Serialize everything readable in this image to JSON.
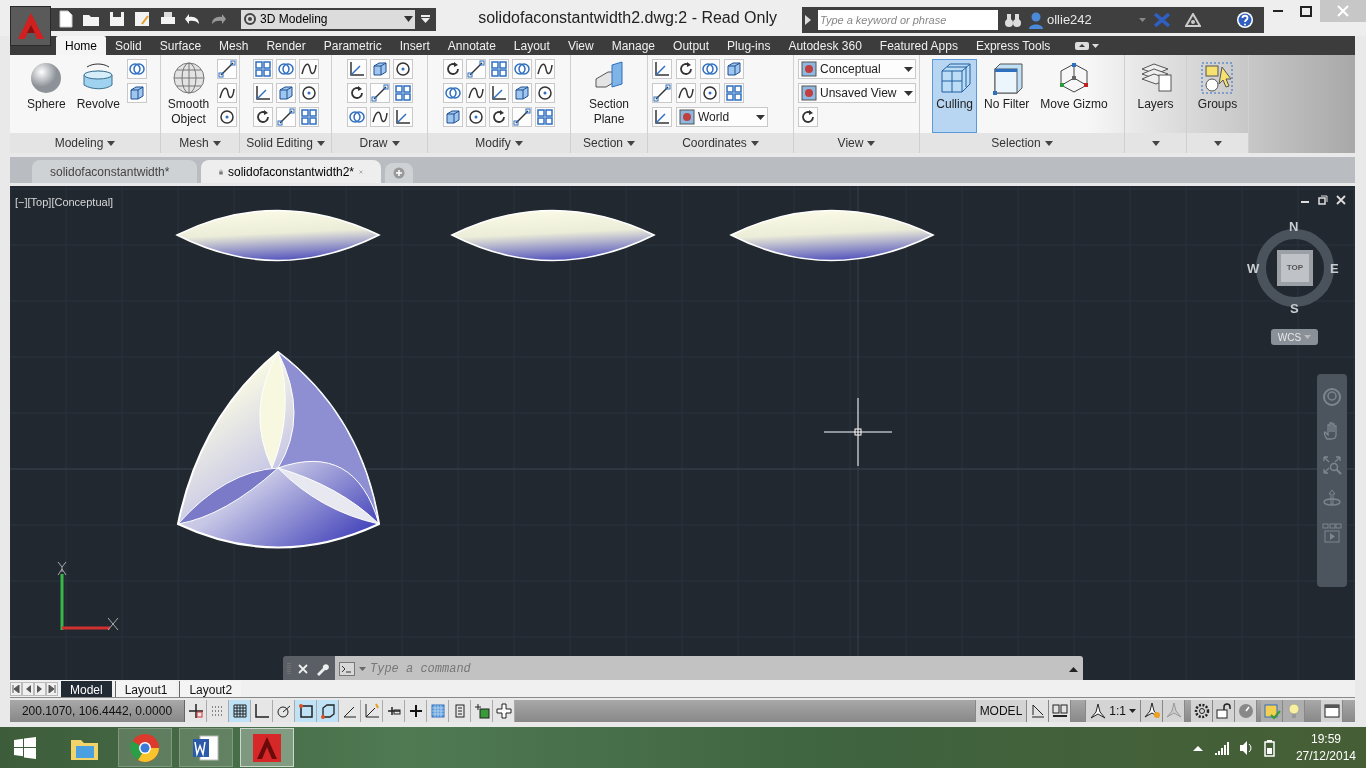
{
  "title_bar": {
    "workspace": "3D Modeling",
    "title": "solidofaconstantwidth2.dwg:2 - Read Only",
    "search": {
      "placeholder": "Type a keyword or phrase"
    },
    "user": "ollie242"
  },
  "ribbon_tabs": [
    {
      "label": "Home",
      "selected": true
    },
    {
      "label": "Solid",
      "selected": false
    },
    {
      "label": "Surface",
      "selected": false
    },
    {
      "label": "Mesh",
      "selected": false
    },
    {
      "label": "Render",
      "selected": false
    },
    {
      "label": "Parametric",
      "selected": false
    },
    {
      "label": "Insert",
      "selected": false
    },
    {
      "label": "Annotate",
      "selected": false
    },
    {
      "label": "Layout",
      "selected": false
    },
    {
      "label": "View",
      "selected": false
    },
    {
      "label": "Manage",
      "selected": false
    },
    {
      "label": "Output",
      "selected": false
    },
    {
      "label": "Plug-ins",
      "selected": false
    },
    {
      "label": "Autodesk 360",
      "selected": false
    },
    {
      "label": "Featured Apps",
      "selected": false
    },
    {
      "label": "Express Tools",
      "selected": false
    }
  ],
  "panels": [
    {
      "title": "Modeling",
      "tools": [
        {
          "kind": "large",
          "label": "Sphere"
        },
        {
          "kind": "large",
          "label": "Revolve"
        }
      ]
    },
    {
      "title": "Mesh",
      "tools": [
        {
          "kind": "large",
          "label": "Smooth Object"
        }
      ]
    },
    {
      "title": "Solid Editing"
    },
    {
      "title": "Draw"
    },
    {
      "title": "Modify"
    },
    {
      "title": "Section",
      "tools": [
        {
          "kind": "large",
          "label": "Section Plane"
        }
      ]
    },
    {
      "title": "Coordinates",
      "tools": [
        {
          "kind": "dropdown",
          "label": "World"
        }
      ]
    },
    {
      "title": "View",
      "tools": [
        {
          "kind": "dropdown",
          "label": "Conceptual"
        },
        {
          "kind": "dropdown",
          "label": "Unsaved View"
        }
      ]
    },
    {
      "title": "Selection",
      "tools": [
        {
          "kind": "large",
          "label": "Culling",
          "active": true
        },
        {
          "kind": "large",
          "label": "No Filter",
          "active": false
        },
        {
          "kind": "large",
          "label": "Move Gizmo",
          "active": false
        }
      ]
    },
    {
      "tools": [
        {
          "kind": "large",
          "label": "Layers"
        }
      ]
    },
    {
      "tools": [
        {
          "kind": "large",
          "label": "Groups"
        }
      ]
    }
  ],
  "file_tabs": [
    {
      "label": "solidofaconstantwidth*",
      "selected": false
    },
    {
      "label": "solidofaconstantwidth2*",
      "selected": true
    }
  ],
  "viewport": {
    "label": "[−][Top][Conceptual]",
    "viewcube": {
      "north": "N",
      "south": "S",
      "east": "E",
      "west": "W",
      "face": "TOP",
      "ucs": "WCS"
    }
  },
  "command_line": {
    "placeholder": "Type a command"
  },
  "layout_tabs": [
    {
      "label": "Model",
      "selected": true
    },
    {
      "label": "Layout1",
      "selected": false
    },
    {
      "label": "Layout2",
      "selected": false
    }
  ],
  "status_bar": {
    "coordinates": "200.1070, 106.4442, 0.0000",
    "toggles": [
      {
        "on": false
      },
      {
        "on": false
      },
      {
        "on": true
      },
      {
        "on": false
      },
      {
        "on": false
      },
      {
        "on": true
      },
      {
        "on": true
      },
      {
        "on": false
      },
      {
        "on": false
      },
      {
        "on": false
      },
      {
        "on": false
      },
      {
        "on": false
      },
      {
        "on": false
      },
      {
        "on": false
      },
      {
        "on": false
      }
    ],
    "space": "MODEL",
    "scale": "1:1"
  },
  "taskbar": {
    "time": "19:59",
    "date": "27/12/2014"
  }
}
